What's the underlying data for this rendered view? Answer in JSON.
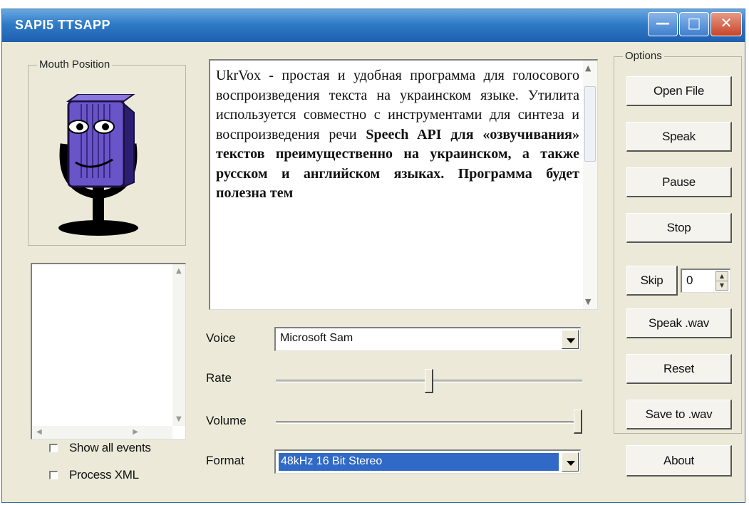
{
  "window": {
    "title": "SAPI5 TTSAPP",
    "controls": {
      "minimize": "—",
      "maximize": "□",
      "close": "✕"
    }
  },
  "mouth_position": {
    "label": "Mouth Position",
    "avatar_icon": "microphone-face-icon"
  },
  "text_area": {
    "segments": [
      {
        "text": "UkrVox - простая и удобная программа для голосового воспроизведения текста на украинском языке. Утилита используется совместно с инструментами для синтеза и воспроизведения речи ",
        "bold": false
      },
      {
        "text": "Speech API для «озвучивания» текстов преимущественно на украинском, а также русском и английском языках. Программа будет полезна тем",
        "bold": true
      }
    ]
  },
  "controls": {
    "voice": {
      "label": "Voice",
      "value": "Microsoft Sam"
    },
    "rate": {
      "label": "Rate",
      "level": 0.5
    },
    "volume": {
      "label": "Volume",
      "level": 1.0
    },
    "format": {
      "label": "Format",
      "value": "48kHz 16 Bit Stereo"
    }
  },
  "events_list": {
    "items": []
  },
  "checkboxes": {
    "show_all_events": {
      "label": "Show all events",
      "checked": false
    },
    "process_xml": {
      "label": "Process XML",
      "checked": false
    }
  },
  "options": {
    "label": "Options",
    "open_file": "Open File",
    "speak": "Speak",
    "pause": "Pause",
    "stop": "Stop",
    "skip": "Skip",
    "skip_value": "0",
    "speak_wav": "Speak .wav",
    "reset": "Reset",
    "save_to_wav": "Save to .wav"
  },
  "about": "About",
  "colors": {
    "title_bar": "#2f7bc6",
    "selection": "#3169c6",
    "dialog_bg": "#ece9d8"
  }
}
